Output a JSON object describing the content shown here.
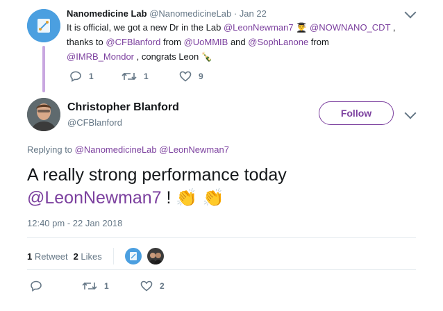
{
  "parent_tweet": {
    "name": "Nanomedicine Lab",
    "handle": "@NanomedicineLab",
    "dot": "·",
    "date": "Jan 22",
    "text_parts": {
      "t1": "It is official, we got a new Dr in the Lab ",
      "m1": "@LeonNewman7",
      "e1": "👨‍🎓",
      "m2": "@NOWNANO_CDT",
      "t2": " ,",
      "t3": "thanks to ",
      "m3": "@CFBlanford",
      "t4": " from ",
      "m4": "@UoMMIB",
      "t5": "  and ",
      "m5": "@SophLanone",
      "t6": " from",
      "m6": "@IMRB_Mondor",
      "t7": " , congrats Leon ",
      "e2": "🍾"
    },
    "actions": {
      "replies": "1",
      "retweets": "1",
      "likes": "9"
    }
  },
  "main_tweet": {
    "name": "Christopher Blanford",
    "handle": "@CFBlanford",
    "follow_label": "Follow",
    "replying_label": "Replying to ",
    "replying_to_1": "@NanomedicineLab",
    "replying_to_2": "@LeonNewman7",
    "text_line1": "A really strong performance today",
    "text_mention": "@LeonNewman7",
    "text_tail": " ! ",
    "text_emoji": "👏 👏",
    "timestamp": "12:40 pm - 22 Jan 2018",
    "stats": {
      "retweet_count": "1",
      "retweet_label": "Retweet",
      "like_count": "2",
      "like_label": "Likes"
    },
    "actions": {
      "retweets": "1",
      "likes": "2"
    }
  },
  "colors": {
    "accent": "#7b3f9e",
    "muted": "#657786"
  }
}
